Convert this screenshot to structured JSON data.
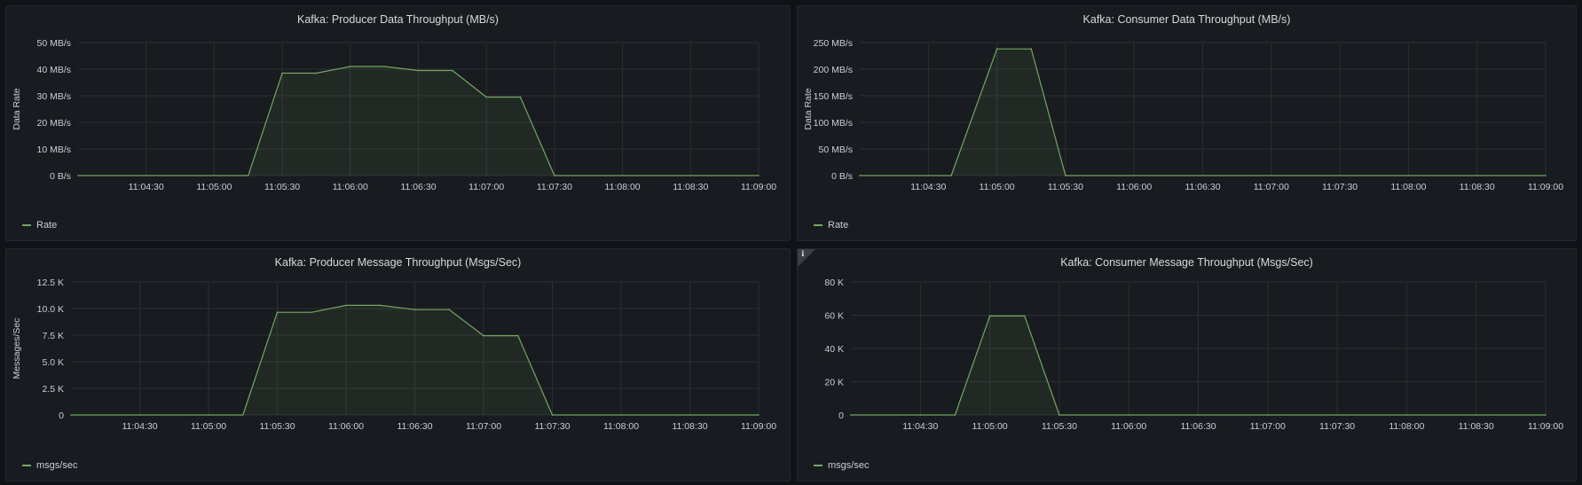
{
  "colors": {
    "series": "#73a761",
    "fill": "rgba(115,167,97,0.10)",
    "grid": "#2c2f33"
  },
  "chart_data": [
    {
      "type": "area",
      "title": "Kafka: Producer Data Throughput (MB/s)",
      "ylabel": "Data Rate",
      "xlabel": "",
      "x_ticks": [
        "11:04:30",
        "11:05:00",
        "11:05:30",
        "11:06:00",
        "11:06:30",
        "11:07:00",
        "11:07:30",
        "11:08:00",
        "11:08:30",
        "11:09:00"
      ],
      "y_ticks": [
        "0 B/s",
        "10 MB/s",
        "20 MB/s",
        "30 MB/s",
        "40 MB/s",
        "50 MB/s"
      ],
      "xlim": [
        "11:04:00",
        "11:09:00"
      ],
      "ylim": [
        0,
        50
      ],
      "grid": true,
      "legend_position": "bottom-left",
      "series": [
        {
          "name": "Rate",
          "x": [
            "11:04:00",
            "11:05:15",
            "11:05:30",
            "11:05:45",
            "11:06:00",
            "11:06:15",
            "11:06:30",
            "11:06:45",
            "11:07:00",
            "11:07:15",
            "11:07:30",
            "11:09:00"
          ],
          "values": [
            0,
            0,
            38.5,
            38.5,
            41,
            41,
            39.5,
            39.5,
            29.5,
            29.5,
            0,
            0
          ]
        }
      ]
    },
    {
      "type": "area",
      "title": "Kafka: Consumer Data Throughput (MB/s)",
      "ylabel": "Data Rate",
      "xlabel": "",
      "x_ticks": [
        "11:04:30",
        "11:05:00",
        "11:05:30",
        "11:06:00",
        "11:06:30",
        "11:07:00",
        "11:07:30",
        "11:08:00",
        "11:08:30",
        "11:09:00"
      ],
      "y_ticks": [
        "0 B/s",
        "50 MB/s",
        "100 MB/s",
        "150 MB/s",
        "200 MB/s",
        "250 MB/s"
      ],
      "xlim": [
        "11:04:00",
        "11:09:00"
      ],
      "ylim": [
        0,
        250
      ],
      "grid": true,
      "legend_position": "bottom-left",
      "series": [
        {
          "name": "Rate",
          "x": [
            "11:04:00",
            "11:04:40",
            "11:05:00",
            "11:05:15",
            "11:05:30",
            "11:09:00"
          ],
          "values": [
            0,
            0,
            238,
            238,
            0,
            0
          ]
        }
      ]
    },
    {
      "type": "area",
      "title": "Kafka: Producer Message Throughput (Msgs/Sec)",
      "ylabel": "Messages/Sec",
      "xlabel": "",
      "x_ticks": [
        "11:04:30",
        "11:05:00",
        "11:05:30",
        "11:06:00",
        "11:06:30",
        "11:07:00",
        "11:07:30",
        "11:08:00",
        "11:08:30",
        "11:09:00"
      ],
      "y_ticks": [
        "0",
        "2.5 K",
        "5.0 K",
        "7.5 K",
        "10.0 K",
        "12.5 K"
      ],
      "xlim": [
        "11:04:00",
        "11:09:00"
      ],
      "ylim": [
        0,
        12500
      ],
      "grid": true,
      "legend_position": "bottom-left",
      "series": [
        {
          "name": "msgs/sec",
          "x": [
            "11:04:00",
            "11:05:15",
            "11:05:30",
            "11:05:45",
            "11:06:00",
            "11:06:15",
            "11:06:30",
            "11:06:45",
            "11:07:00",
            "11:07:15",
            "11:07:30",
            "11:09:00"
          ],
          "values": [
            0,
            0,
            9650,
            9650,
            10300,
            10300,
            9900,
            9900,
            7450,
            7450,
            0,
            0
          ]
        }
      ]
    },
    {
      "type": "area",
      "title": "Kafka: Consumer Message Throughput (Msgs/Sec)",
      "ylabel": "",
      "xlabel": "",
      "x_ticks": [
        "11:04:30",
        "11:05:00",
        "11:05:30",
        "11:06:00",
        "11:06:30",
        "11:07:00",
        "11:07:30",
        "11:08:00",
        "11:08:30",
        "11:09:00"
      ],
      "y_ticks": [
        "0",
        "20 K",
        "40 K",
        "60 K",
        "80 K"
      ],
      "xlim": [
        "11:04:00",
        "11:09:00"
      ],
      "ylim": [
        0,
        80000
      ],
      "grid": true,
      "legend_position": "bottom-left",
      "series": [
        {
          "name": "msgs/sec",
          "x": [
            "11:04:00",
            "11:04:45",
            "11:05:00",
            "11:05:15",
            "11:05:30",
            "11:09:00"
          ],
          "values": [
            0,
            0,
            59500,
            59500,
            0,
            0
          ]
        }
      ]
    }
  ]
}
